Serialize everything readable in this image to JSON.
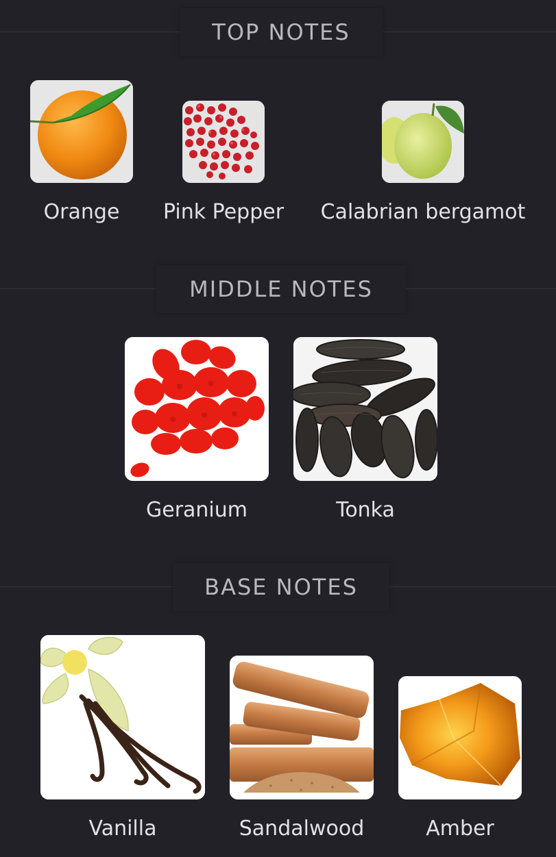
{
  "sections": {
    "top": {
      "title": "TOP NOTES",
      "notes": [
        {
          "label": "Orange",
          "icon": "orange-icon"
        },
        {
          "label": "Pink Pepper",
          "icon": "pink-pepper-icon"
        },
        {
          "label": "Calabrian bergamot",
          "icon": "bergamot-icon"
        }
      ]
    },
    "middle": {
      "title": "MIDDLE NOTES",
      "notes": [
        {
          "label": "Geranium",
          "icon": "geranium-icon"
        },
        {
          "label": "Tonka",
          "icon": "tonka-icon"
        }
      ]
    },
    "base": {
      "title": "BASE NOTES",
      "notes": [
        {
          "label": "Vanilla",
          "icon": "vanilla-icon"
        },
        {
          "label": "Sandalwood",
          "icon": "sandalwood-icon"
        },
        {
          "label": "Amber",
          "icon": "amber-icon"
        }
      ]
    }
  },
  "colors": {
    "background": "#222127",
    "header_text": "#b9b8c0",
    "label_text": "#e2e1e7"
  }
}
